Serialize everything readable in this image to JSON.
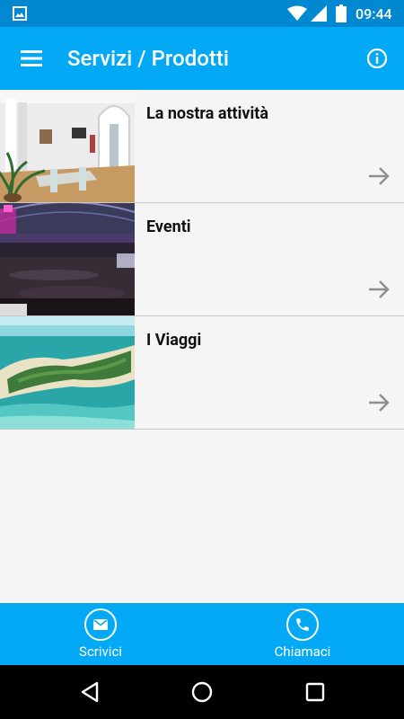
{
  "status_bar": {
    "time": "09:44",
    "icons": [
      "image-notification-icon",
      "wifi-icon",
      "signal-icon",
      "battery-icon"
    ]
  },
  "app_bar": {
    "title": "Servizi / Prodotti",
    "menu_icon": "hamburger-menu-icon",
    "info_icon": "info-icon"
  },
  "items": [
    {
      "label": "La nostra attività",
      "image": "office-interior-photo",
      "icon": "arrow-right-icon"
    },
    {
      "label": "Eventi",
      "image": "concert-crowd-photo",
      "icon": "arrow-right-icon"
    },
    {
      "label": "I Viaggi",
      "image": "tropical-island-photo",
      "icon": "arrow-right-icon"
    }
  ],
  "bottom_bar": {
    "write_label": "Scrivici",
    "call_label": "Chiamaci",
    "write_icon": "email-icon",
    "call_icon": "phone-icon"
  },
  "colors": {
    "primary": "#03a9f4",
    "primary_dark": "#0288d1",
    "background": "#f5f5f5"
  }
}
